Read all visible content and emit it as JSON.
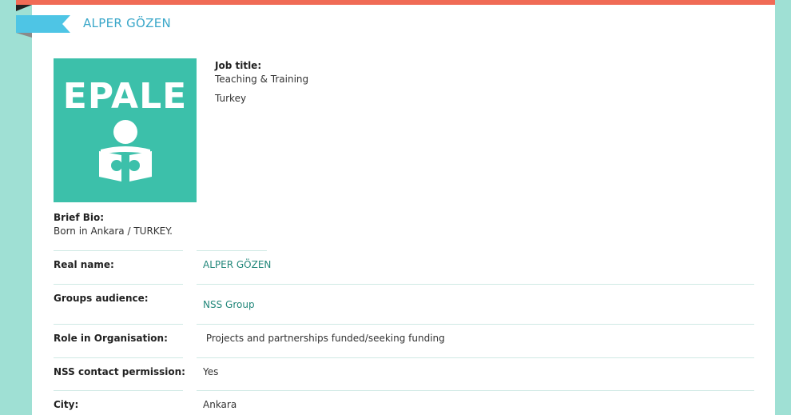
{
  "profile": {
    "name": "ALPER GÖZEN",
    "avatar_text": "EPALE",
    "job_title_label": "Job title:",
    "job_title": "Teaching & Training",
    "country": "Turkey",
    "bio_label": "Brief Bio:",
    "bio": "Born in Ankara / TURKEY."
  },
  "details": [
    {
      "label": "Real name:",
      "value": "ALPER GÖZEN"
    },
    {
      "label": "Groups audience:",
      "value": "NSS Group"
    },
    {
      "label": "Role in Organisation:",
      "value": " Projects and partnerships funded/seeking funding"
    },
    {
      "label": "NSS contact permission:",
      "value": "Yes"
    },
    {
      "label": "City:",
      "value": "Ankara"
    }
  ],
  "colors": {
    "accent_top": "#f06b56",
    "ribbon": "#4ec5e5",
    "avatar_bg": "#3cc0aa",
    "link": "#22877a",
    "background": "#9fe0d4"
  }
}
